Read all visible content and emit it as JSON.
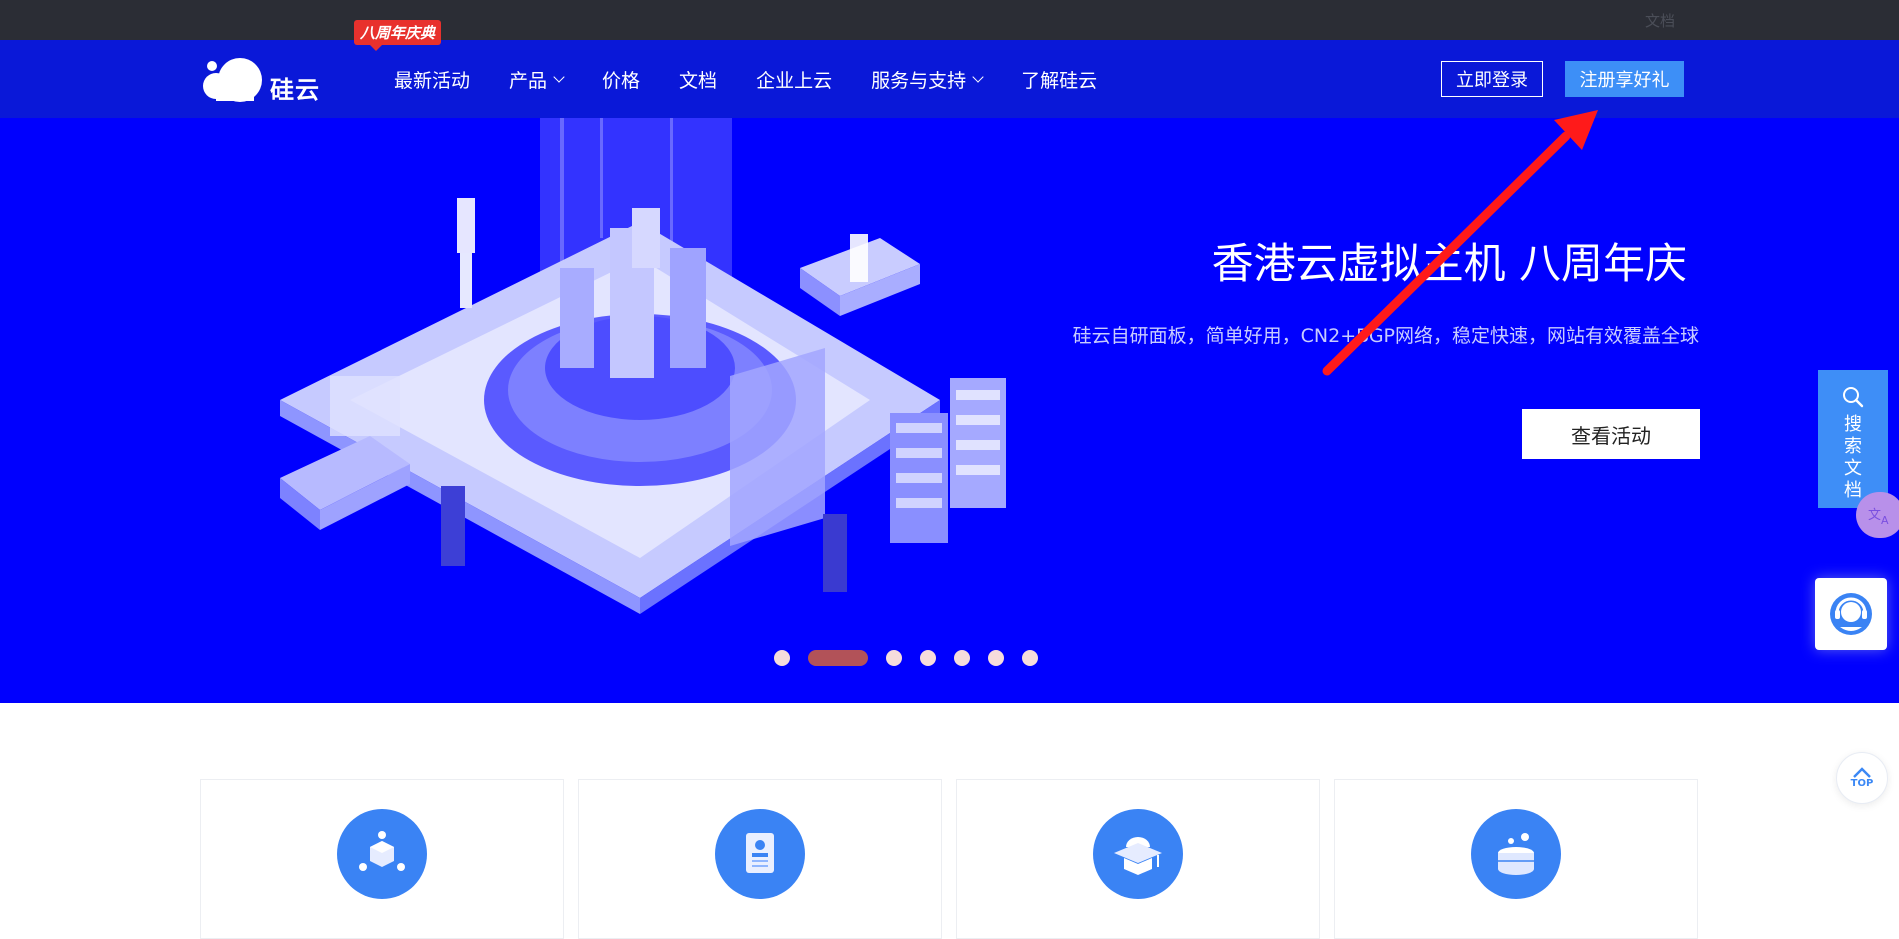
{
  "topbar": {
    "doc_link": "文档"
  },
  "logo": {
    "text": "硅云"
  },
  "nav": {
    "promo_badge": "八周年庆典",
    "items": [
      {
        "label": "最新活动",
        "dropdown": false
      },
      {
        "label": "产品",
        "dropdown": true
      },
      {
        "label": "价格",
        "dropdown": false
      },
      {
        "label": "文档",
        "dropdown": false
      },
      {
        "label": "企业上云",
        "dropdown": false
      },
      {
        "label": "服务与支持",
        "dropdown": true
      },
      {
        "label": "了解硅云",
        "dropdown": false
      }
    ],
    "login_label": "立即登录",
    "register_label": "注册享好礼"
  },
  "banner": {
    "title": "香港云虚拟主机 八周年庆",
    "subtitle": "硅云自研面板，简单好用，CN2+BGP网络，稳定快速，网站有效覆盖全球",
    "button_label": "查看活动",
    "slides_total": 7,
    "active_slide": 2
  },
  "sidebar": {
    "search_doc_label": "搜索文档",
    "top_label": "TOP"
  },
  "cards": [
    {
      "icon": "cube-network-icon",
      "title": ""
    },
    {
      "icon": "document-card-icon",
      "title": ""
    },
    {
      "icon": "graduation-cap-icon",
      "title": ""
    },
    {
      "icon": "database-icon",
      "title": ""
    }
  ],
  "colors": {
    "topbar": "#2b2d35",
    "nav": "#0a18d8",
    "banner": "#0000fe",
    "accent": "#3d8ff7",
    "promo": "#e8312d",
    "arrow": "#ff1a1a"
  }
}
